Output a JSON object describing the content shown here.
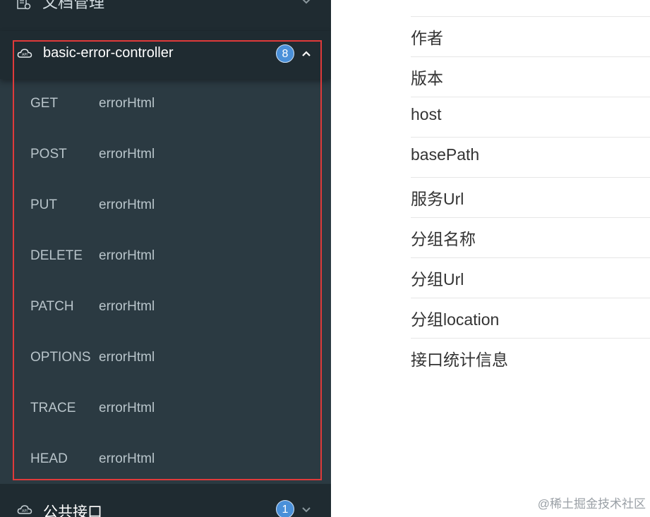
{
  "sidebar": {
    "top_item": {
      "label": "文档管理"
    },
    "open_group": {
      "label": "basic-error-controller",
      "count": "8",
      "operations": [
        {
          "method": "GET",
          "name": "errorHtml"
        },
        {
          "method": "POST",
          "name": "errorHtml"
        },
        {
          "method": "PUT",
          "name": "errorHtml"
        },
        {
          "method": "DELETE",
          "name": "errorHtml"
        },
        {
          "method": "PATCH",
          "name": "errorHtml"
        },
        {
          "method": "OPTIONS",
          "name": "errorHtml"
        },
        {
          "method": "TRACE",
          "name": "errorHtml"
        },
        {
          "method": "HEAD",
          "name": "errorHtml"
        }
      ]
    },
    "bottom_group": {
      "label": "公共接口",
      "count": "1"
    }
  },
  "content": {
    "rows": [
      "作者",
      "版本",
      "host",
      "basePath",
      "服务Url",
      "分组名称",
      "分组Url",
      "分组location",
      "接口统计信息"
    ]
  },
  "watermark": "@稀土掘金技术社区",
  "colors": {
    "sidebar_bg": "#1f2b31",
    "group_bg": "#2b3a42",
    "badge": "#4a90d9",
    "highlight": "#e03a3a"
  },
  "icons": {
    "top_item": "document-settings-icon",
    "group": "cloud-api-icon",
    "expand": "chevron-up-icon",
    "collapse": "chevron-down-icon"
  }
}
